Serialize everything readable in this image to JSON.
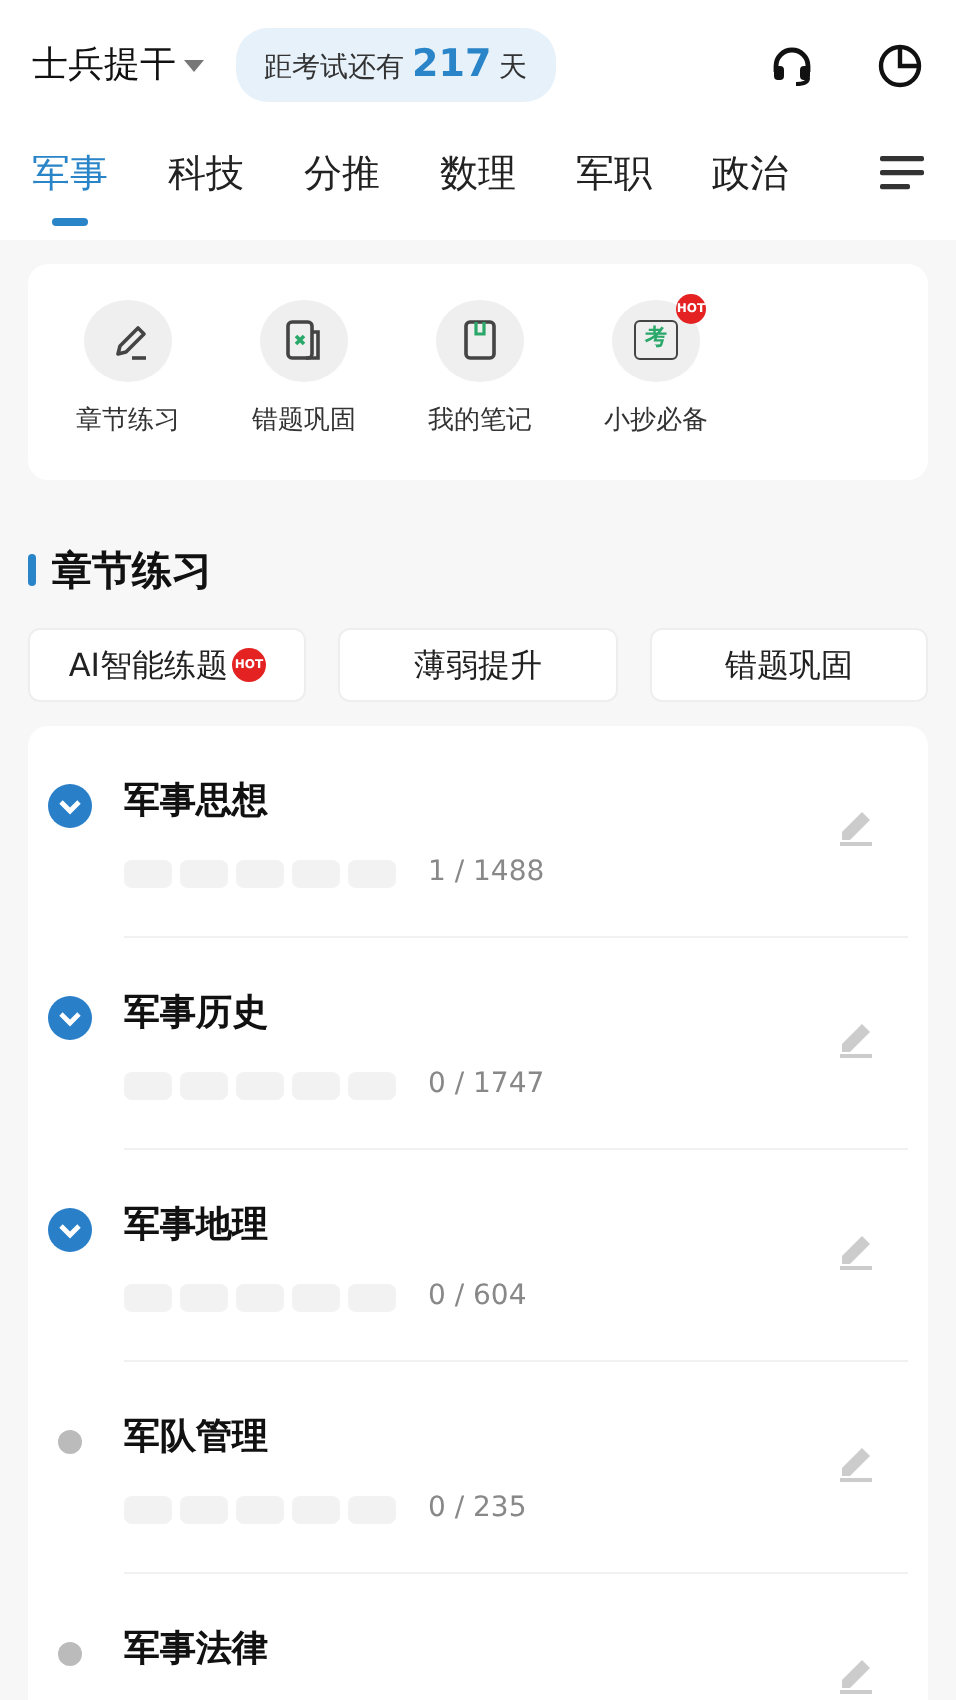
{
  "header": {
    "exam_type": "士兵提干",
    "countdown": {
      "prefix": "距考试还有",
      "days": "217",
      "suffix": "天"
    }
  },
  "tabs": [
    {
      "label": "军事",
      "selected": true
    },
    {
      "label": "科技",
      "selected": false
    },
    {
      "label": "分推",
      "selected": false
    },
    {
      "label": "数理",
      "selected": false
    },
    {
      "label": "军职",
      "selected": false
    },
    {
      "label": "政治",
      "selected": false
    }
  ],
  "shortcuts": [
    {
      "label": "章节练习",
      "kind": "pencil",
      "hot": false
    },
    {
      "label": "错题巩固",
      "kind": "wrong",
      "hot": false
    },
    {
      "label": "我的笔记",
      "kind": "notebook",
      "hot": false
    },
    {
      "label": "小抄必备",
      "kind": "exam",
      "hot": true,
      "icon_text": "考",
      "hot_text": "HOT"
    }
  ],
  "section_title": "章节练习",
  "mode_buttons": [
    {
      "label": "AI智能练题",
      "hot": true,
      "hot_text": "HOT"
    },
    {
      "label": "薄弱提升",
      "hot": false
    },
    {
      "label": "错题巩固",
      "hot": false
    }
  ],
  "chapters": [
    {
      "title": "军事思想",
      "kind": "expandable",
      "count": "1 / 1488"
    },
    {
      "title": "军事历史",
      "kind": "expandable",
      "count": "0 / 1747"
    },
    {
      "title": "军事地理",
      "kind": "expandable",
      "count": "0 / 604"
    },
    {
      "title": "军队管理",
      "kind": "leaf",
      "count": "0 / 235"
    },
    {
      "title": "军事法律",
      "kind": "leaf"
    }
  ]
}
